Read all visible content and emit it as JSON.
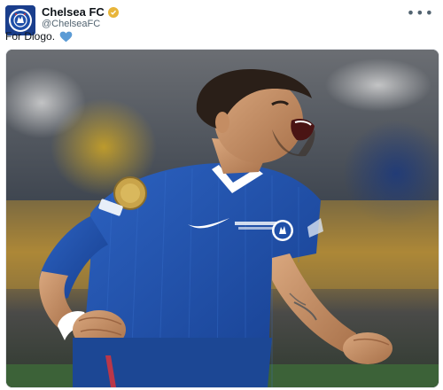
{
  "account": {
    "display_name": "Chelsea FC",
    "handle": "@ChelseaFC",
    "verified_badge": "gold-verified-icon"
  },
  "menu": {
    "more_label": "•••"
  },
  "tweet": {
    "text": "For Diogo.",
    "emoji": "blue-heart-icon"
  },
  "colors": {
    "club_blue": "#1f4fa8",
    "verified_gold": "#e8b53a",
    "heart_blue": "#5b9bd5"
  }
}
